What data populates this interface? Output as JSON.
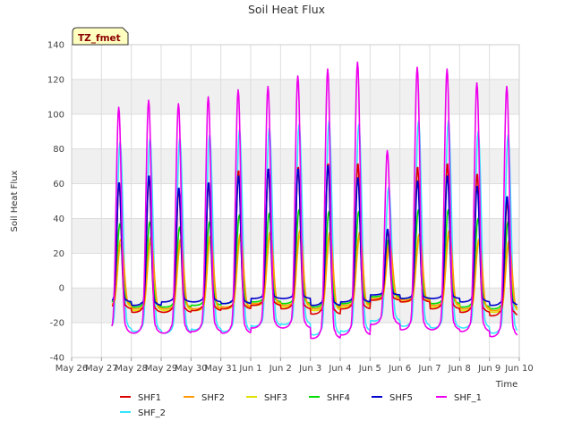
{
  "title": "Soil Heat Flux",
  "badge": "TZ_fmet",
  "xlabel": "Time",
  "ylabel": "Soil Heat Flux",
  "colors": {
    "band": "#f0f0f0",
    "grid": "#dddddd",
    "badge_fill": "#ffffc0",
    "badge_stroke": "#333333"
  },
  "chart_data": {
    "type": "line",
    "title": "Soil Heat Flux",
    "xlabel": "Time",
    "ylabel": "Soil Heat Flux",
    "ylim": [
      -40,
      140
    ],
    "xlim": [
      "2024-05-26",
      "2024-06-10"
    ],
    "grid": true,
    "legend_position": "bottom",
    "y_ticks": [
      -40,
      -20,
      0,
      20,
      40,
      60,
      80,
      100,
      120,
      140
    ],
    "x_tick_labels": [
      "May 26",
      "May 27",
      "May 28",
      "May 29",
      "May 30",
      "May 31",
      "Jun 1",
      "Jun 2",
      "Jun 3",
      "Jun 4",
      "Jun 5",
      "Jun 6",
      "Jun 7",
      "Jun 8",
      "Jun 9",
      "Jun 10"
    ],
    "days": [
      "May 27",
      "May 28",
      "May 29",
      "May 30",
      "May 31",
      "Jun 1",
      "Jun 2",
      "Jun 3",
      "Jun 4",
      "Jun 5",
      "Jun 6",
      "Jun 7",
      "Jun 8",
      "Jun 9"
    ],
    "series": [
      {
        "name": "SHF1",
        "color": "#dd0000",
        "daily_max": [
          61,
          64,
          57,
          61,
          68,
          69,
          70,
          72,
          72,
          33,
          70,
          72,
          66,
          50
        ],
        "daily_min": [
          -12,
          -14,
          -14,
          -13,
          -12,
          -10,
          -12,
          -15,
          -12,
          -7,
          -8,
          -12,
          -14,
          -16
        ]
      },
      {
        "name": "SHF2",
        "color": "#ff9900",
        "daily_max": [
          28,
          29,
          28,
          30,
          31,
          32,
          33,
          32,
          32,
          26,
          31,
          33,
          28,
          27
        ],
        "daily_min": [
          -10,
          -12,
          -12,
          -12,
          -11,
          -9,
          -10,
          -12,
          -10,
          -6,
          -7,
          -10,
          -12,
          -13
        ]
      },
      {
        "name": "SHF3",
        "color": "#e0e000",
        "daily_max": [
          25,
          26,
          25,
          27,
          28,
          29,
          30,
          29,
          29,
          22,
          28,
          30,
          26,
          24
        ],
        "daily_min": [
          -11,
          -13,
          -13,
          -13,
          -12,
          -10,
          -11,
          -13,
          -11,
          -7,
          -8,
          -11,
          -13,
          -14
        ]
      },
      {
        "name": "SHF4",
        "color": "#00dd00",
        "daily_max": [
          37,
          38,
          35,
          38,
          42,
          43,
          45,
          44,
          44,
          28,
          45,
          45,
          40,
          38
        ],
        "daily_min": [
          -9,
          -11,
          -11,
          -10,
          -9,
          -8,
          -9,
          -11,
          -9,
          -5,
          -6,
          -9,
          -11,
          -12
        ]
      },
      {
        "name": "SHF5",
        "color": "#0000cc",
        "daily_max": [
          61,
          65,
          58,
          61,
          65,
          69,
          69,
          71,
          64,
          34,
          62,
          65,
          59,
          53
        ],
        "daily_min": [
          -8,
          -10,
          -8,
          -8,
          -9,
          -6,
          -6,
          -10,
          -8,
          -4,
          -6,
          -6,
          -8,
          -10
        ]
      },
      {
        "name": "SHF_1",
        "color": "#ee00ee",
        "daily_max": [
          104,
          108,
          106,
          110,
          114,
          116,
          122,
          126,
          130,
          79,
          127,
          126,
          118,
          116
        ],
        "daily_min": [
          -26,
          -26,
          -26,
          -25,
          -26,
          -23,
          -23,
          -29,
          -27,
          -21,
          -24,
          -24,
          -25,
          -28
        ]
      },
      {
        "name": "SHF_2",
        "color": "#33e6ff",
        "daily_max": [
          84,
          86,
          86,
          88,
          91,
          92,
          94,
          96,
          94,
          58,
          96,
          96,
          90,
          88
        ],
        "daily_min": [
          -24,
          -25,
          -26,
          -24,
          -25,
          -22,
          -21,
          -27,
          -25,
          -19,
          -22,
          -23,
          -23,
          -26
        ]
      }
    ]
  },
  "legend": {
    "row1": [
      "SHF1",
      "SHF2",
      "SHF3",
      "SHF4",
      "SHF5",
      "SHF_1"
    ],
    "row2": [
      "SHF_2"
    ]
  }
}
